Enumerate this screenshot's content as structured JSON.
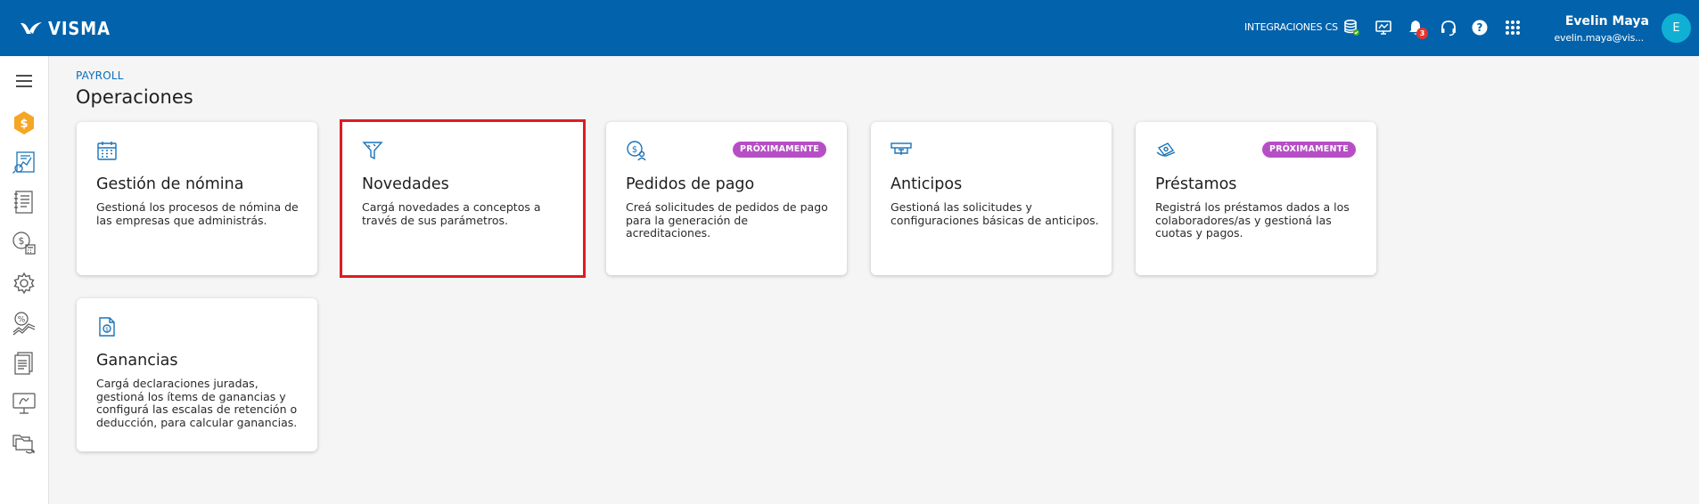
{
  "header": {
    "brand": "VISMA",
    "company": "INTEGRACIONES CS",
    "notifications_count": "3",
    "user_name": "Evelin Maya",
    "user_email": "evelin.maya@vis...",
    "avatar_initial": "E",
    "icons": [
      "database-check-icon",
      "monitor-chart-icon",
      "bell-icon",
      "headset-icon",
      "help-icon",
      "apps-grid-icon"
    ]
  },
  "sidebar": {
    "items": [
      "menu-icon",
      "payroll-dollar-icon",
      "reports-chart-icon",
      "list-document-icon",
      "salary-calculator-icon",
      "settings-gear-icon",
      "percent-growth-icon",
      "document-icon",
      "monitor-sign-icon",
      "folders-sync-icon"
    ]
  },
  "breadcrumb": "PAYROLL",
  "title": "Operaciones",
  "cards": [
    {
      "title": "Gestión de nómina",
      "desc": "Gestioná los procesos de nómina de las empresas que administrás.",
      "icon": "calendar-icon",
      "badge": ""
    },
    {
      "title": "Novedades",
      "desc": "Cargá novedades a conceptos a través de sus parámetros.",
      "icon": "funnel-icon",
      "badge": ""
    },
    {
      "title": "Pedidos de pago",
      "desc": "Creá solicitudes de pedidos de pago para la generación de acreditaciones.",
      "icon": "money-user-icon",
      "badge": "PRÓXIMAMENTE"
    },
    {
      "title": "Anticipos",
      "desc": "Gestioná las solicitudes y configuraciones básicas de anticipos.",
      "icon": "cash-withdraw-icon",
      "badge": ""
    },
    {
      "title": "Préstamos",
      "desc": "Registrá los préstamos dados a los colaboradores/as y gestioná las cuotas y pagos.",
      "icon": "money-hand-icon",
      "badge": "PRÓXIMAMENTE"
    },
    {
      "title": "Ganancias",
      "desc": "Cargá declaraciones juradas, gestioná los ítems de ganancias y configurá las escalas de retención o deducción, para calcular ganancias.",
      "icon": "document-coin-icon",
      "badge": ""
    }
  ],
  "colors": {
    "header_bg": "#0262ab",
    "accent": "#0a6fb9",
    "badge_purple": "#b64fc5",
    "selection_red": "#e01b22"
  }
}
